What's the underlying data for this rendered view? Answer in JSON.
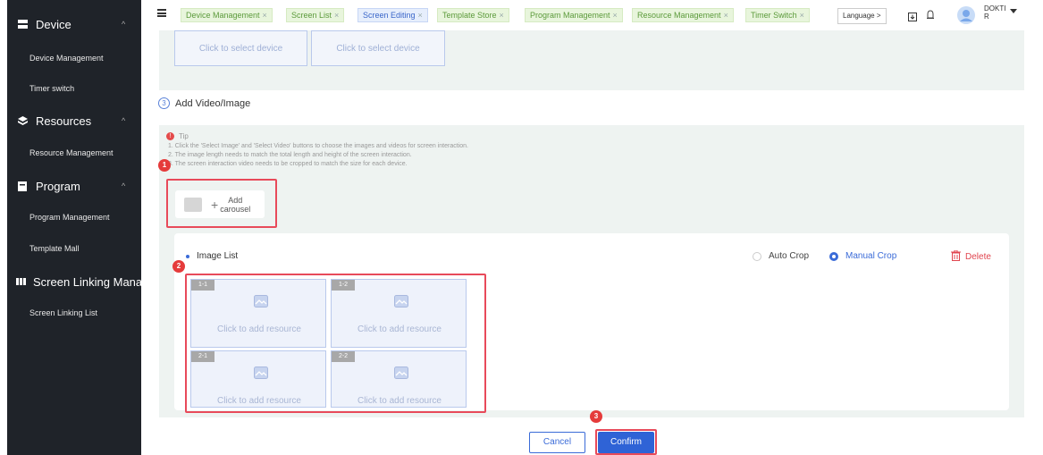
{
  "sidebar": {
    "groups": [
      {
        "label": "Device",
        "icon": "server-icon",
        "items": [
          "Device Management",
          "Timer switch"
        ]
      },
      {
        "label": "Resources",
        "icon": "layers-icon",
        "items": [
          "Resource Management"
        ]
      },
      {
        "label": "Program",
        "icon": "program-icon",
        "items": [
          "Program Management",
          "Template Mall"
        ]
      },
      {
        "label": "Screen Linking Manage",
        "icon": "grid-icon",
        "items": [
          "Screen Linking List"
        ]
      }
    ]
  },
  "topbar": {
    "tabs": [
      {
        "label": "Device Management",
        "active": false
      },
      {
        "label": "Screen List",
        "active": false
      },
      {
        "label": "Screen Editing",
        "active": true
      },
      {
        "label": "Template Store",
        "active": false
      },
      {
        "label": "Program Management",
        "active": false
      },
      {
        "label": "Resource Management",
        "active": false
      },
      {
        "label": "Timer Switch",
        "active": false
      }
    ],
    "close_glyph": "×",
    "language_label": "Language >",
    "user_name_line1": "DOKTI",
    "user_name_line2": "R"
  },
  "device_select": {
    "labels": [
      "Click to select device",
      "Click to select device"
    ]
  },
  "step3": {
    "number": "3",
    "title": "Add Video/Image"
  },
  "tip": {
    "title": "Tip",
    "lines": [
      "1. Click the 'Select Image' and 'Select Video' buttons to choose the images and videos for screen interaction.",
      "2. The image length needs to match the total length and height of the screen interaction.",
      "3. The screen interaction video needs to be cropped to match the size for each device."
    ]
  },
  "badges": {
    "one": "1",
    "two": "2",
    "three": "3"
  },
  "carousel": {
    "label_line1": "Add",
    "label_line2": "carousel",
    "plus": "+"
  },
  "image_list": {
    "title": "Image List",
    "auto_crop": "Auto Crop",
    "manual_crop": "Manual Crop",
    "selected_crop": "Manual Crop",
    "delete": "Delete",
    "tiles": [
      {
        "tag": "1-1",
        "label": "Click to add resource"
      },
      {
        "tag": "1-2",
        "label": "Click to add resource"
      },
      {
        "tag": "2-1",
        "label": "Click to add resource"
      },
      {
        "tag": "2-2",
        "label": "Click to add resource"
      }
    ]
  },
  "actions": {
    "cancel": "Cancel",
    "confirm": "Confirm"
  },
  "colors": {
    "sidebar_bg": "#1f2329",
    "accent": "#3a6bd8",
    "highlight": "#e84a5a",
    "tab_green": "#5b9a3a"
  }
}
